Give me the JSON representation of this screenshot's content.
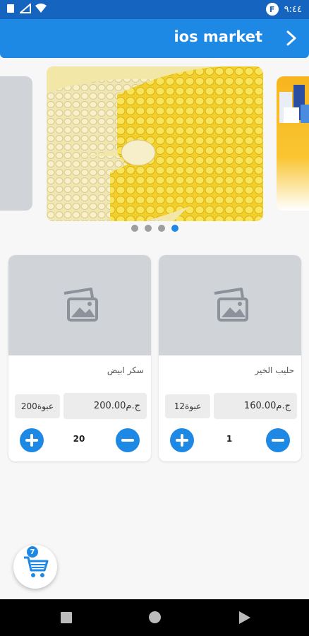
{
  "status_bar": {
    "time": "٩:٤٤",
    "badge": "F"
  },
  "app_bar": {
    "title": "ios market"
  },
  "carousel": {
    "active_index": 3,
    "dot_count": 4
  },
  "products": [
    {
      "name": "سكر ابيض",
      "price": "200.00ج.م",
      "stock": "200عبوة",
      "quantity": "20"
    },
    {
      "name": "حليب الخير",
      "price": "160.00ج.م",
      "stock": "12عبوة",
      "quantity": "1"
    }
  ],
  "cart": {
    "count": "7"
  },
  "colors": {
    "primary": "#1e88e5",
    "status_bar": "#1565c0",
    "placeholder": "#d0d3d8"
  }
}
